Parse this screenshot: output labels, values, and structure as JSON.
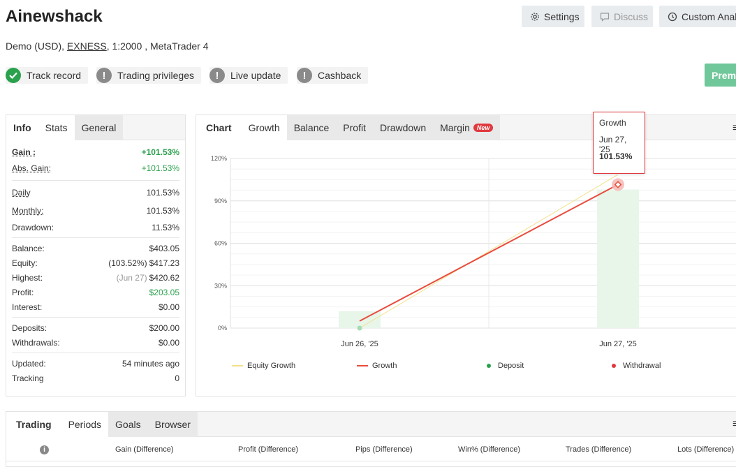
{
  "header": {
    "title": "Ainewshack",
    "account_type": "Demo (USD),",
    "broker": "EXNESS",
    "leverage_platform": ", 1:2000 , MetaTrader 4",
    "settings_label": "Settings",
    "discuss_label": "Discuss",
    "custom_label": "Custom Analy",
    "premium_label": "Premi"
  },
  "badges": {
    "track_record": "Track record",
    "trading_privileges": "Trading privileges",
    "live_update": "Live update",
    "cashback": "Cashback"
  },
  "stats_panel": {
    "tabs": [
      "Info",
      "Stats",
      "General"
    ],
    "gain_label": "Gain :",
    "gain_value": "+101.53%",
    "abs_gain_label": "Abs. Gain:",
    "abs_gain_value": "+101.53%",
    "daily_label": "Daily",
    "daily_value": "101.53%",
    "monthly_label": "Monthly:",
    "monthly_value": "101.53%",
    "drawdown_label": "Drawdown:",
    "drawdown_value": "11.53%",
    "balance_label": "Balance:",
    "balance_value": "$403.05",
    "equity_label": "Equity:",
    "equity_pre": "(103.52%)",
    "equity_value": "$417.23",
    "highest_label": "Highest:",
    "highest_pre": "(Jun 27)",
    "highest_value": "$420.62",
    "profit_label": "Profit:",
    "profit_value": "$203.05",
    "interest_label": "Interest:",
    "interest_value": "$0.00",
    "deposits_label": "Deposits:",
    "deposits_value": "$200.00",
    "withdrawals_label": "Withdrawals:",
    "withdrawals_value": "$0.00",
    "updated_label": "Updated:",
    "updated_value": "54 minutes ago",
    "tracking_label": "Tracking",
    "tracking_value": "0"
  },
  "chart_panel": {
    "tabs": [
      "Chart",
      "Growth",
      "Balance",
      "Profit",
      "Drawdown",
      "Margin"
    ],
    "new_badge": "New",
    "tooltip": {
      "series": "Growth",
      "date": "Jun 27, '25",
      "value": "101.53%"
    },
    "legend": {
      "equity": "Equity Growth",
      "growth": "Growth",
      "deposit": "Deposit",
      "withdrawal": "Withdrawal"
    }
  },
  "chart_data": {
    "type": "line",
    "x": [
      "Jun 26, '25",
      "Jun 27, '25"
    ],
    "yticks": [
      "0%",
      "30%",
      "60%",
      "90%",
      "120%"
    ],
    "ylim": [
      0,
      120
    ],
    "series": [
      {
        "name": "Equity Growth",
        "values": [
          0,
          108.6
        ],
        "color": "#f3e08a"
      },
      {
        "name": "Growth",
        "values": [
          5,
          101.53
        ],
        "color": "#e84c3d"
      }
    ],
    "bars": {
      "name": "Deposit",
      "values": [
        12,
        98
      ],
      "color": "#e8f6ea"
    },
    "deposit_point": {
      "x": "Jun 26, '25",
      "y": 0
    },
    "colors": {
      "growth": "#e84c3d",
      "equity": "#f3e08a",
      "deposit": "#2aa14d",
      "withdrawal": "#e0393e"
    }
  },
  "trading_panel": {
    "tabs": [
      "Trading",
      "Periods",
      "Goals",
      "Browser"
    ],
    "columns": [
      "Gain (Difference)",
      "Profit (Difference)",
      "Pips (Difference)",
      "Win% (Difference)",
      "Trades (Difference)",
      "Lots (Difference)"
    ]
  },
  "colors": {
    "green": "#2aa14d",
    "gray_icon": "#8a8a8a",
    "premium": "#6fc79a"
  }
}
